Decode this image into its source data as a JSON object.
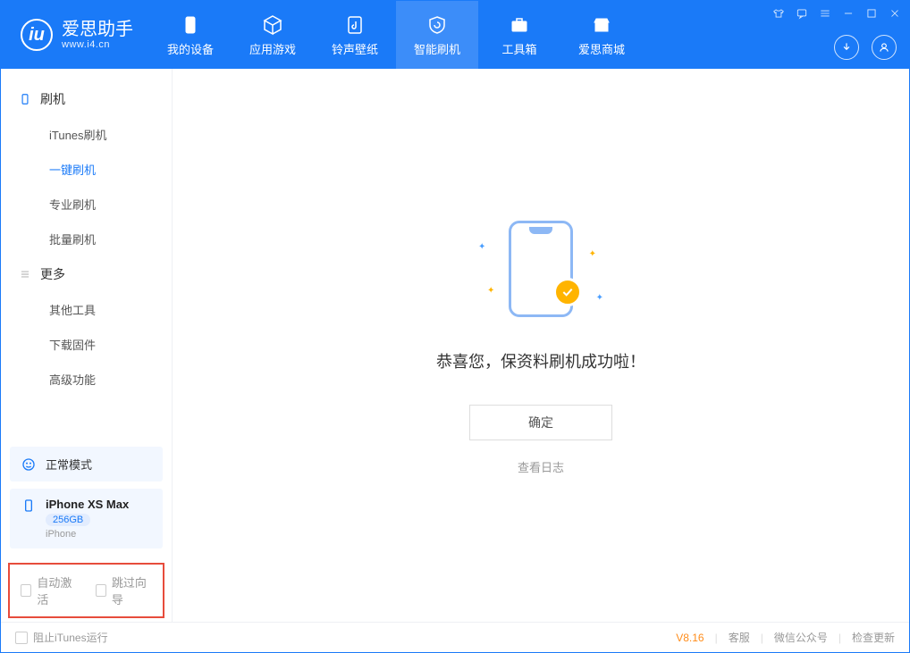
{
  "app": {
    "title": "爱思助手",
    "subtitle": "www.i4.cn"
  },
  "tabs": {
    "device": "我的设备",
    "apps": "应用游戏",
    "ringtones": "铃声壁纸",
    "flash": "智能刷机",
    "toolbox": "工具箱",
    "store": "爱思商城"
  },
  "sidebar": {
    "group_flash": "刷机",
    "items_flash": {
      "itunes": "iTunes刷机",
      "oneclick": "一键刷机",
      "pro": "专业刷机",
      "batch": "批量刷机"
    },
    "group_more": "更多",
    "items_more": {
      "other": "其他工具",
      "firmware": "下载固件",
      "advanced": "高级功能"
    }
  },
  "mode": {
    "label": "正常模式"
  },
  "device": {
    "name": "iPhone XS Max",
    "storage": "256GB",
    "type": "iPhone"
  },
  "checkboxes": {
    "auto_activate": "自动激活",
    "skip_guide": "跳过向导"
  },
  "main": {
    "success": "恭喜您，保资料刷机成功啦！",
    "ok": "确定",
    "viewlog": "查看日志"
  },
  "footer": {
    "block_itunes": "阻止iTunes运行",
    "version": "V8.16",
    "support": "客服",
    "wechat": "微信公众号",
    "update": "检查更新"
  }
}
